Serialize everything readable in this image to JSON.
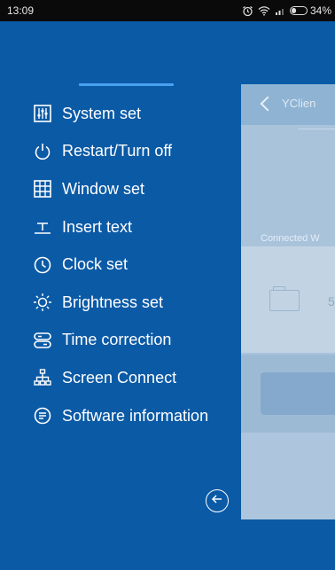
{
  "status_bar": {
    "time": "13:09",
    "battery_text": "34%"
  },
  "drawer": {
    "accent_color": "#48a0f0",
    "background_color": "#0b5aa6",
    "items": [
      {
        "label": "System set",
        "icon": "sliders-icon"
      },
      {
        "label": "Restart/Turn off",
        "icon": "power-icon"
      },
      {
        "label": "Window set",
        "icon": "grid-icon"
      },
      {
        "label": "Insert text",
        "icon": "insert-text-icon"
      },
      {
        "label": "Clock set",
        "icon": "clock-icon"
      },
      {
        "label": "Brightness set",
        "icon": "sun-icon"
      },
      {
        "label": "Time correction",
        "icon": "time-correction-icon"
      },
      {
        "label": "Screen Connect",
        "icon": "network-icon"
      },
      {
        "label": "Software information",
        "icon": "info-list-icon"
      }
    ],
    "back_icon": "back-arrow-icon"
  },
  "background_page": {
    "title": "YClien",
    "section_label": "Connected W",
    "row_value": "5"
  }
}
